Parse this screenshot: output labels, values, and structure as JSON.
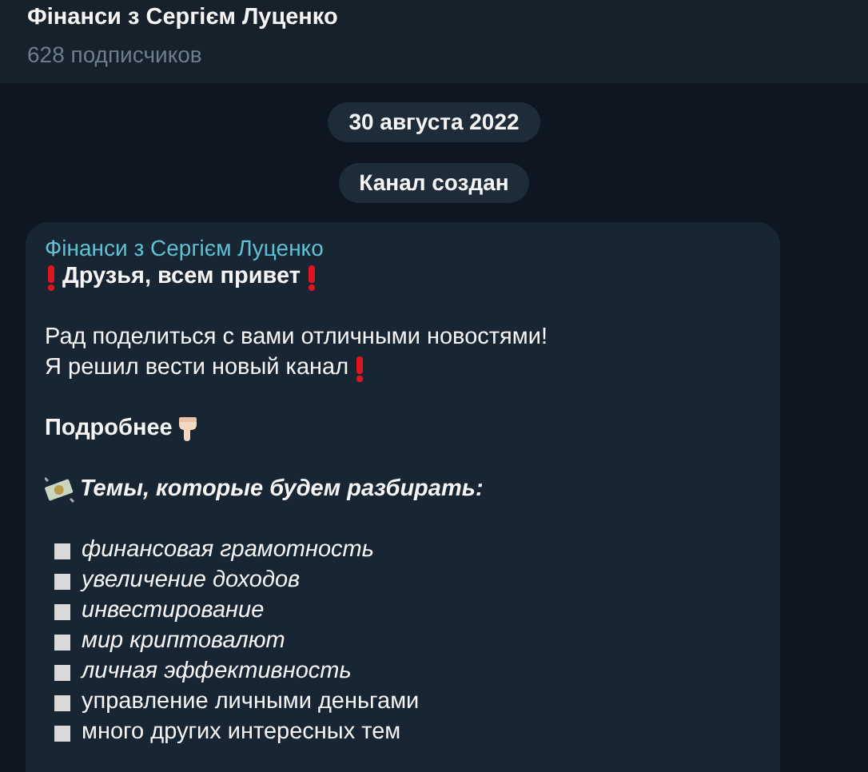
{
  "header": {
    "title": "Фінанси з Сергієм Луценко",
    "subtitle": "628 подписчиков"
  },
  "service_messages": [
    "30 августа 2022",
    "Канал создан"
  ],
  "post": {
    "author": "Фінанси з Сергієм Луценко",
    "lines": [
      {
        "kind": "alert-bold",
        "text": "Друзья, всем привет"
      },
      {
        "kind": "blank"
      },
      {
        "kind": "text",
        "text": "Рад поделиться с вами отличными новостями!"
      },
      {
        "kind": "text-alert",
        "text": "Я решил вести новый канал"
      },
      {
        "kind": "blank"
      },
      {
        "kind": "bold-pointer",
        "text": "Подробнее"
      },
      {
        "kind": "blank"
      },
      {
        "kind": "topics-heading",
        "text": "Темы, которые будем разбирать:"
      },
      {
        "kind": "blank"
      },
      {
        "kind": "bullet",
        "text": "финансовая грамотность",
        "italic": true
      },
      {
        "kind": "bullet",
        "text": "увеличение доходов",
        "italic": true
      },
      {
        "kind": "bullet",
        "text": "инвестирование",
        "italic": true
      },
      {
        "kind": "bullet",
        "text": "мир криптовалют",
        "italic": true
      },
      {
        "kind": "bullet",
        "text": "личная эффективность",
        "italic": true
      },
      {
        "kind": "bullet",
        "text": "управление личными деньгами",
        "italic": false
      },
      {
        "kind": "bullet",
        "text": "много других интересных тем",
        "italic": false
      }
    ]
  }
}
